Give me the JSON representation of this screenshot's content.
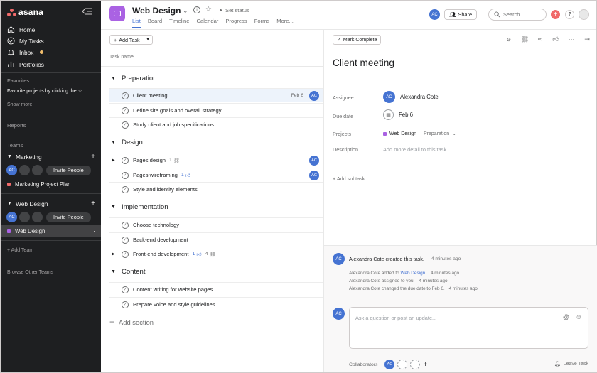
{
  "app": {
    "logo_text": "asana",
    "brand_color": "#f06a6a"
  },
  "sidebar": {
    "nav": [
      {
        "label": "Home",
        "icon": "home-icon"
      },
      {
        "label": "My Tasks",
        "icon": "check-circle-icon"
      },
      {
        "label": "Inbox",
        "icon": "bell-icon"
      },
      {
        "label": "Portfolios",
        "icon": "bar-chart-icon"
      }
    ],
    "favorites_label": "Favorites",
    "favorites_hint": "Favorite projects by clicking the",
    "show_more": "Show more",
    "reports": "Reports",
    "teams_label": "Teams",
    "teams": [
      {
        "name": "Marketing",
        "invite": "Invite People",
        "member_initials": "AC",
        "projects": [
          {
            "name": "Marketing Project Plan",
            "color": "#f06a6a"
          }
        ]
      },
      {
        "name": "Web Design",
        "invite": "Invite People",
        "member_initials": "AC",
        "projects": [
          {
            "name": "Web Design",
            "color": "#aa62e3",
            "more": "···"
          }
        ]
      }
    ],
    "add_team": "Add Team",
    "browse_teams": "Browse Other Teams"
  },
  "header": {
    "project_title": "Web Design",
    "set_status": "Set status",
    "tabs": [
      "List",
      "Board",
      "Timeline",
      "Calendar",
      "Progress",
      "Forms",
      "More..."
    ],
    "active_tab": "List",
    "avatar_initials": "AC",
    "share": "Share",
    "search_placeholder": "Search",
    "help": "?"
  },
  "list": {
    "add_task": "Add Task",
    "column_task_name": "Task name",
    "add_section": "Add section",
    "sections": [
      {
        "name": "Preparation",
        "tasks": [
          {
            "name": "Client meeting",
            "date": "Feb 6",
            "assignee": "AC"
          },
          {
            "name": "Define site goals and overall strategy"
          },
          {
            "name": "Study client and job specifications"
          }
        ]
      },
      {
        "name": "Design",
        "tasks": [
          {
            "name": "Pages design",
            "subtasks": "1",
            "assignee": "AC"
          },
          {
            "name": "Pages wireframing",
            "likes": "1",
            "assignee": "AC"
          },
          {
            "name": "Style and identity elements"
          }
        ]
      },
      {
        "name": "Implementation",
        "tasks": [
          {
            "name": "Choose technology"
          },
          {
            "name": "Back-end development"
          },
          {
            "name": "Front-end development",
            "likes": "1",
            "subtasks": "4"
          }
        ]
      },
      {
        "name": "Content",
        "tasks": [
          {
            "name": "Content writing for website pages"
          },
          {
            "name": "Prepare voice and style guidelines"
          }
        ]
      }
    ]
  },
  "detail": {
    "mark_complete": "Mark Complete",
    "title": "Client meeting",
    "assignee_label": "Assignee",
    "assignee_initials": "AC",
    "assignee_name": "Alexandra Cote",
    "due_label": "Due date",
    "due_value": "Feb 6",
    "projects_label": "Projects",
    "project_name": "Web Design",
    "project_section": "Preparation",
    "description_label": "Description",
    "description_placeholder": "Add more detail to this task...",
    "add_subtask": "Add subtask",
    "activity": {
      "main_initials": "AC",
      "main_text": "Alexandra Cote created this task.",
      "main_time": "4 minutes ago",
      "items": [
        {
          "pre": "Alexandra Cote added to ",
          "link": "Web Design",
          "post": ".",
          "time": "4 minutes ago"
        },
        {
          "pre": "Alexandra Cote assigned to you.",
          "link": "",
          "post": "",
          "time": "4 minutes ago"
        },
        {
          "pre": "Alexandra Cote changed the due date to Feb 6.",
          "link": "",
          "post": "",
          "time": "4 minutes ago"
        }
      ]
    },
    "comment_initials": "AC",
    "comment_placeholder": "Ask a question or post an update...",
    "collaborators_label": "Collaborators",
    "collaborator_initials": "AC",
    "leave_task": "Leave Task"
  }
}
